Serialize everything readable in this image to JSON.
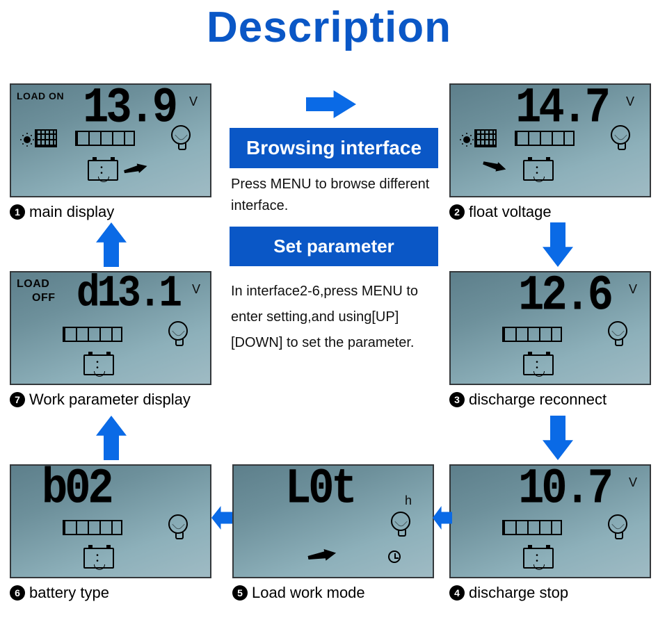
{
  "title": "Description",
  "center": {
    "browsing_heading": "Browsing interface",
    "browsing_desc": "Press MENU to browse different  interface.",
    "set_heading": "Set parameter",
    "set_desc": "In interface2-6,press MENU to enter setting,and using[UP] [DOWN] to set the parameter."
  },
  "screens": {
    "s1": {
      "num": "1",
      "caption": "main display",
      "label": "LOAD ON",
      "value": "13.9",
      "unit": "V"
    },
    "s2": {
      "num": "2",
      "caption": "float voltage",
      "label": "",
      "value": "14.7",
      "unit": "V"
    },
    "s3": {
      "num": "3",
      "caption": "discharge reconnect",
      "label": "",
      "value": "12.6",
      "unit": "V"
    },
    "s4": {
      "num": "4",
      "caption": "discharge stop",
      "label": "",
      "value": "10.7",
      "unit": "V"
    },
    "s5": {
      "num": "5",
      "caption": "Load work mode",
      "label": "",
      "value": "L0t",
      "unit": "h"
    },
    "s6": {
      "num": "6",
      "caption": "battery type",
      "label": "",
      "value": "b02",
      "unit": ""
    },
    "s7": {
      "num": "7",
      "caption": "Work parameter display",
      "label": "LOAD OFF",
      "value": "d13.1",
      "unit": "V"
    }
  }
}
